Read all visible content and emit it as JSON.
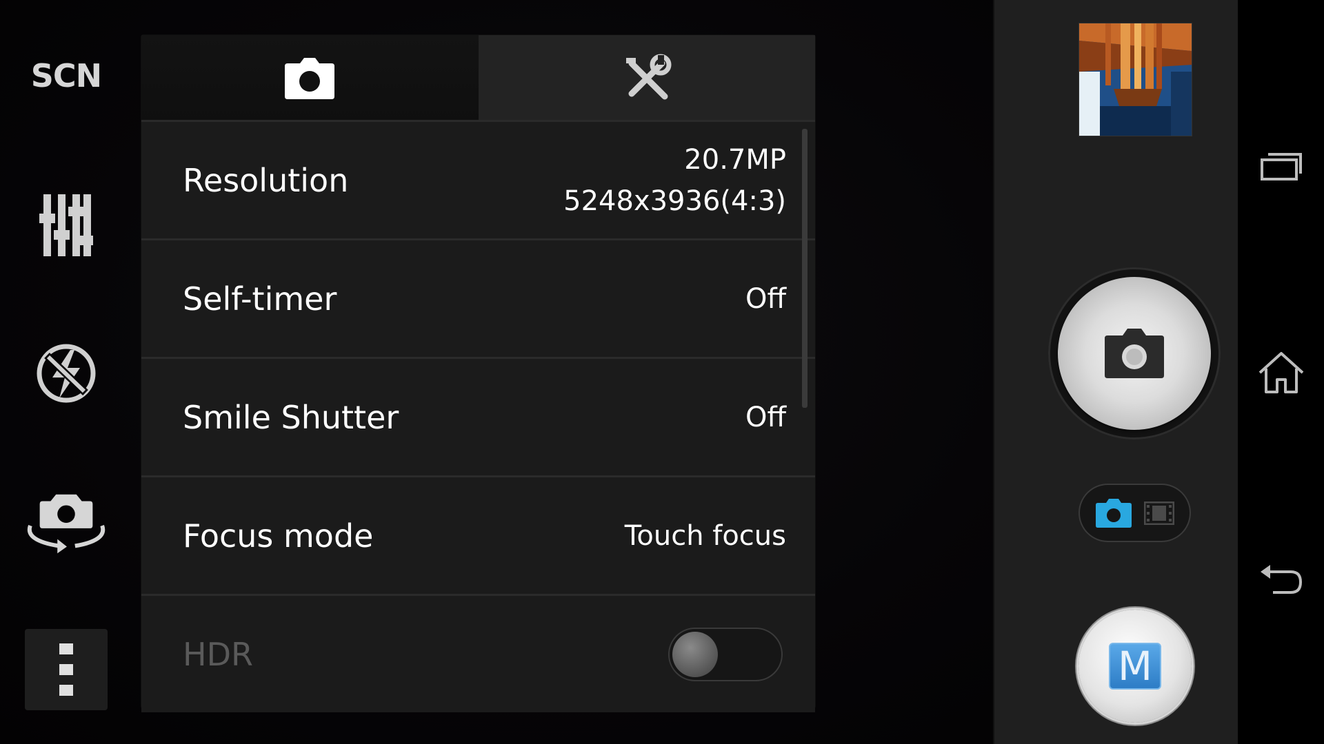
{
  "left_rail": {
    "scene_label": "SCN",
    "icons": [
      "equalizer-icon",
      "flash-off-icon",
      "switch-camera-icon",
      "more-options-icon"
    ]
  },
  "settings_panel": {
    "tabs": [
      {
        "icon": "camera-icon",
        "active": true
      },
      {
        "icon": "tools-icon",
        "active": false
      }
    ],
    "rows": [
      {
        "label": "Resolution",
        "value_line1": "20.7MP",
        "value_line2": "5248x3936(4:3)"
      },
      {
        "label": "Self-timer",
        "value": "Off"
      },
      {
        "label": "Smile Shutter",
        "value": "Off"
      },
      {
        "label": "Focus mode",
        "value": "Touch focus"
      },
      {
        "label": "HDR",
        "toggle_on": false,
        "disabled": true
      }
    ]
  },
  "right_controls": {
    "thumbnail_icon": "last-photo-thumbnail",
    "shutter_icon": "camera-icon",
    "mode_switch": {
      "photo_active": true,
      "icons": [
        "camera-icon",
        "video-film-icon"
      ]
    },
    "manual_mode_label": "M"
  },
  "nav_bar": {
    "icons": [
      "recent-apps-icon",
      "home-icon",
      "back-icon"
    ]
  },
  "colors": {
    "accent": "#29a8e0",
    "panel_bg": "#1b1b1b",
    "divider": "#2b2b2b",
    "disabled_text": "#5a5a5a"
  }
}
